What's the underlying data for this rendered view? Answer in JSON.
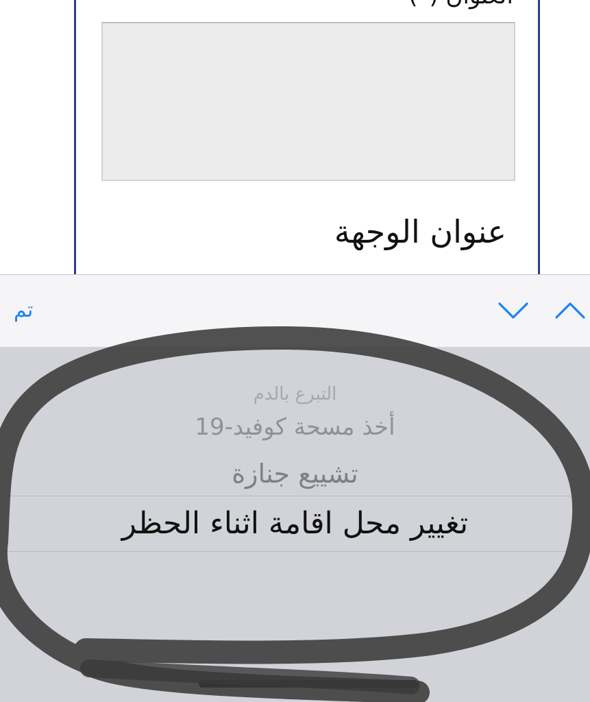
{
  "form": {
    "top_label": "العنوان (*)",
    "address_value": "",
    "destination_label": "عنوان الوجهة"
  },
  "toolbar": {
    "done_label": "تم",
    "prev_icon": "chevron-up-icon",
    "next_icon": "chevron-down-icon",
    "accent_color": "#1a82f7"
  },
  "picker": {
    "options": [
      "",
      "التبرع بالدم",
      "أخذ مسحة كوفيد-19",
      "تشييع جنازة",
      "تغيير محل اقامة اثناء الحظر"
    ],
    "selected": "تغيير محل اقامة اثناء الحظر"
  },
  "annotation": {
    "shape": "hand-drawn-ellipse",
    "color": "#3a3a3a"
  }
}
